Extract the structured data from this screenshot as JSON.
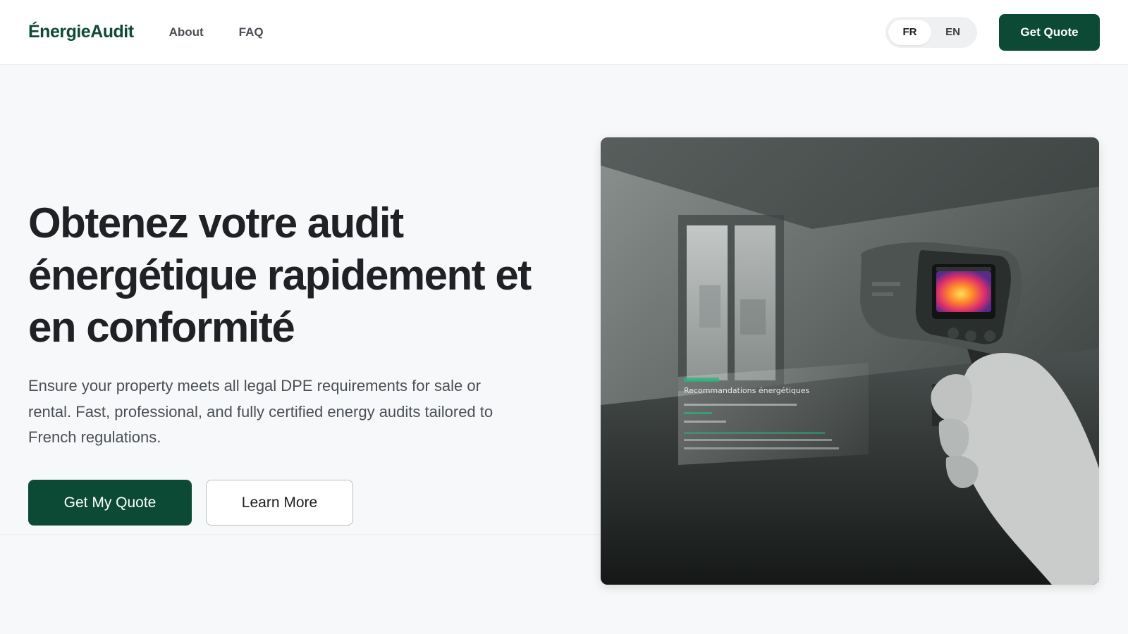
{
  "nav": {
    "logo": "ÉnergieAudit",
    "links": [
      "About",
      "FAQ"
    ],
    "languages": [
      "FR",
      "EN"
    ],
    "active_language": "FR",
    "cta": "Get Quote"
  },
  "hero": {
    "title": "Obtenez votre audit énergétique rapidement et en conformité",
    "subtitle": "Ensure your property meets all legal DPE requirements for sale or rental. Fast, professional, and fully certified energy audits tailored to French regulations.",
    "primary_cta": "Get My Quote",
    "secondary_cta": "Learn More",
    "image_overlay_heading": "Recommandations énergétiques",
    "image_subject": "thermal-camera-in-empty-room"
  },
  "colors": {
    "brand": "#0d4a36",
    "background": "#f7f8f9",
    "text": "#1f2124",
    "muted": "#4a4f55"
  }
}
